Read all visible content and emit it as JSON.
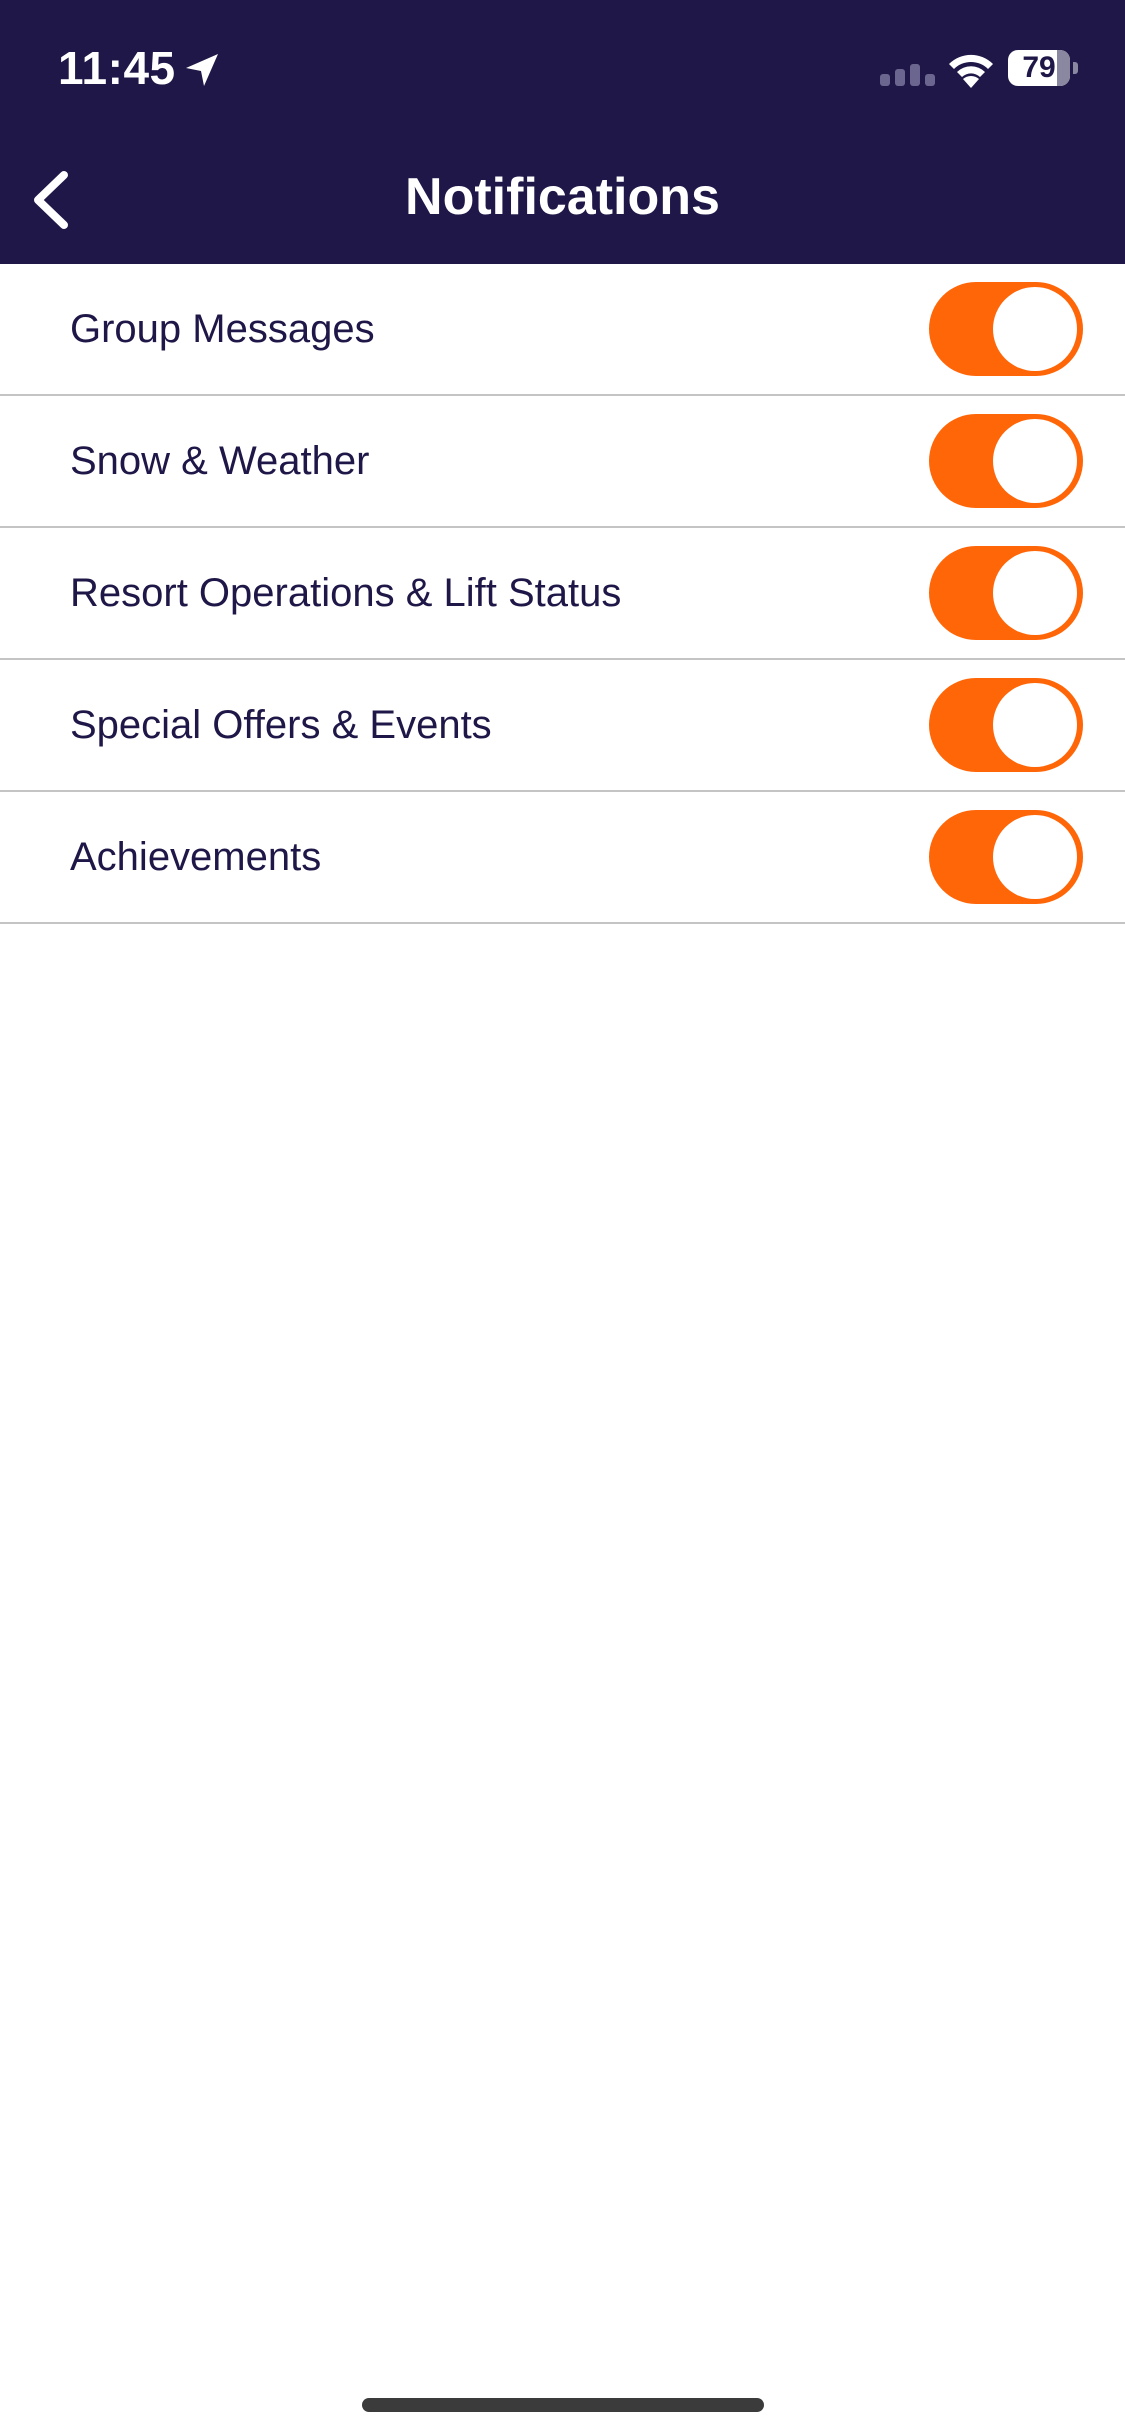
{
  "status_bar": {
    "time": "11:45",
    "battery_level": "79",
    "battery_fraction": 0.79,
    "icons": [
      "location-arrow-icon",
      "cellular-signal-icon",
      "wifi-icon",
      "battery-icon"
    ]
  },
  "header": {
    "title": "Notifications",
    "back_icon": "chevron-left-icon"
  },
  "settings": [
    {
      "label": "Group Messages",
      "enabled": true
    },
    {
      "label": "Snow & Weather",
      "enabled": true
    },
    {
      "label": "Resort Operations & Lift Status",
      "enabled": true
    },
    {
      "label": "Special Offers & Events",
      "enabled": true
    },
    {
      "label": "Achievements",
      "enabled": true
    }
  ],
  "colors": {
    "header_background": "#1f1747",
    "accent": "#ff6608",
    "label_text": "#1f1747",
    "divider": "#c4c4c4"
  }
}
